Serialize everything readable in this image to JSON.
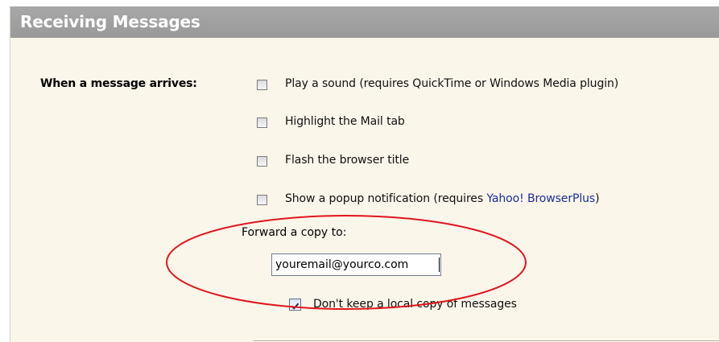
{
  "section": {
    "title": "Receiving Messages"
  },
  "arrives": {
    "label": "When a message arrives:",
    "options": [
      {
        "label": "Play a sound (requires QuickTime or Windows Media plugin)",
        "checked": false
      },
      {
        "label": "Highlight the Mail tab",
        "checked": false
      },
      {
        "label": "Flash the browser title",
        "checked": false
      },
      {
        "label_prefix": "Show a popup notification (requires ",
        "link": "Yahoo! BrowserPlus",
        "label_suffix": ")",
        "checked": false
      }
    ]
  },
  "forward": {
    "label": "Forward a copy to:",
    "email_value": "youremail@yourco.com",
    "dont_keep_label": "Don't keep a local copy of messages",
    "dont_keep_checked": true
  },
  "colors": {
    "header_bg": "#a0a0a0",
    "panel_bg": "#fbf6ea",
    "annotation": "#e0161e",
    "link": "#1c2d9c"
  }
}
